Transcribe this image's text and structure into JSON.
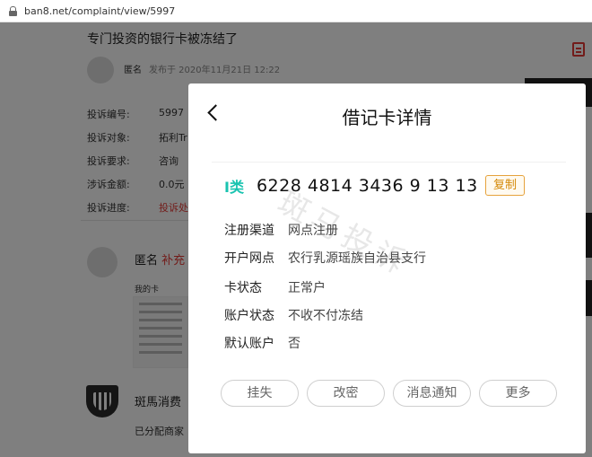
{
  "browser": {
    "url": "ban8.net/complaint/view/5997"
  },
  "page": {
    "title": "专门投资的银行卡被冻结了",
    "author": "匿名",
    "published": "发布于 2020年11月21日 12:22",
    "fields": [
      {
        "label": "投诉编号:",
        "value": "5997"
      },
      {
        "label": "投诉对象:",
        "value": "拓利Tr"
      },
      {
        "label": "投诉要求:",
        "value": "咨询"
      },
      {
        "label": "涉诉金额:",
        "value": "0.0元"
      },
      {
        "label": "投诉进度:",
        "value": "投诉处"
      }
    ],
    "reply_author": "匿名",
    "reply_tag": "补充",
    "reply_text": "我的卡",
    "merchant": "斑馬消费",
    "assigned": "已分配商家"
  },
  "modal": {
    "title": "借记卡详情",
    "card_type": "I类",
    "card_number": "6228 4814 3436 9  13 13",
    "copy_label": "复制",
    "details": [
      {
        "label": "注册渠道",
        "value": "网点注册"
      },
      {
        "label": "开户网点",
        "value": "农行乳源瑶族自治县支行"
      },
      {
        "label": "卡状态",
        "value": "正常户"
      },
      {
        "label": "账户状态",
        "value": "不收不付冻结"
      },
      {
        "label": "默认账户",
        "value": "否"
      }
    ],
    "actions": [
      "挂失",
      "改密",
      "消息通知",
      "更多"
    ],
    "watermark": "斑马投诉"
  },
  "colors": {
    "accent_teal": "#19c3b0",
    "copy_gold": "#d48806",
    "red": "#e53935"
  }
}
